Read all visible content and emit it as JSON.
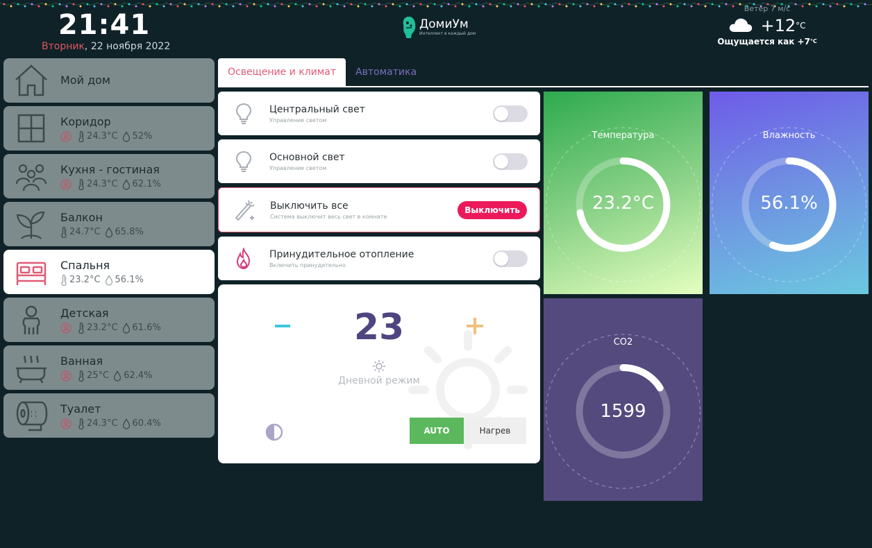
{
  "header": {
    "time": "21:41",
    "date_weekday": "Вторник",
    "date_rest": ", 22 ноября 2022",
    "logo_name": "ДомиУм",
    "logo_tagline": "Интеллект в каждый дом",
    "wind": "Ветер 7 м/с",
    "temp": "+12",
    "temp_unit": "°C",
    "feels_label": "Ощущается как ",
    "feels_value": "+7",
    "feels_unit": "°C",
    "weather_icon": "cloud-icon"
  },
  "rooms": [
    {
      "name": "Мой дом",
      "icon": "house-icon",
      "occupancy": false,
      "temp": "",
      "hum": ""
    },
    {
      "name": "Коридор",
      "icon": "window-icon",
      "occupancy": true,
      "temp": "24.3°C",
      "hum": "52%"
    },
    {
      "name": "Кухня - гостиная",
      "icon": "people-icon",
      "occupancy": true,
      "temp": "24.3°C",
      "hum": "62.1%"
    },
    {
      "name": "Балкон",
      "icon": "plant-icon",
      "occupancy": false,
      "temp": "24.7°C",
      "hum": "65.8%"
    },
    {
      "name": "Спальня",
      "icon": "bed-icon",
      "occupancy": false,
      "temp": "23.2°C",
      "hum": "56.1%"
    },
    {
      "name": "Детская",
      "icon": "child-icon",
      "occupancy": true,
      "temp": "23.2°C",
      "hum": "61.6%"
    },
    {
      "name": "Ванная",
      "icon": "bathtub-icon",
      "occupancy": true,
      "temp": "25°C",
      "hum": "62.4%"
    },
    {
      "name": "Туалет",
      "icon": "toilet-paper-icon",
      "occupancy": true,
      "temp": "24.3°C",
      "hum": "60.4%"
    }
  ],
  "active_room": "Спальня",
  "tabs": [
    {
      "label": "Освещение и климат",
      "active": true
    },
    {
      "label": "Автоматика",
      "active": false
    }
  ],
  "controls": {
    "central_light": {
      "title": "Центральный свет",
      "subtitle": "Управление светом",
      "on": false
    },
    "main_light": {
      "title": "Основной свет",
      "subtitle": "Управление светом",
      "on": false
    },
    "all_off": {
      "title": "Выключить все",
      "subtitle": "Система выключит весь свет в комнате",
      "button": "Выключить"
    },
    "forced_heating": {
      "title": "Принудительное отопление",
      "subtitle": "Включить принудительно",
      "on": false
    }
  },
  "thermostat": {
    "setpoint": "23",
    "mode_label": "Дневной режим",
    "auto_label": "AUTO",
    "heat_label": "Нагрев",
    "selected": "AUTO"
  },
  "sensors": {
    "temperature": {
      "title": "Температура",
      "value": "23.2°C",
      "fraction": 0.72
    },
    "humidity": {
      "title": "Влажность",
      "value": "56.1%",
      "fraction": 0.561
    },
    "co2": {
      "title": "CO2",
      "value": "1599",
      "fraction": 0.16
    }
  },
  "colors": {
    "background": "#0f2228",
    "accent_pink": "#e05a74",
    "button_red": "#ec1a5a",
    "auto_green": "#5cb85c",
    "tab_inactive": "#7c6fc0",
    "room_inactive": "#7d8b8c"
  }
}
